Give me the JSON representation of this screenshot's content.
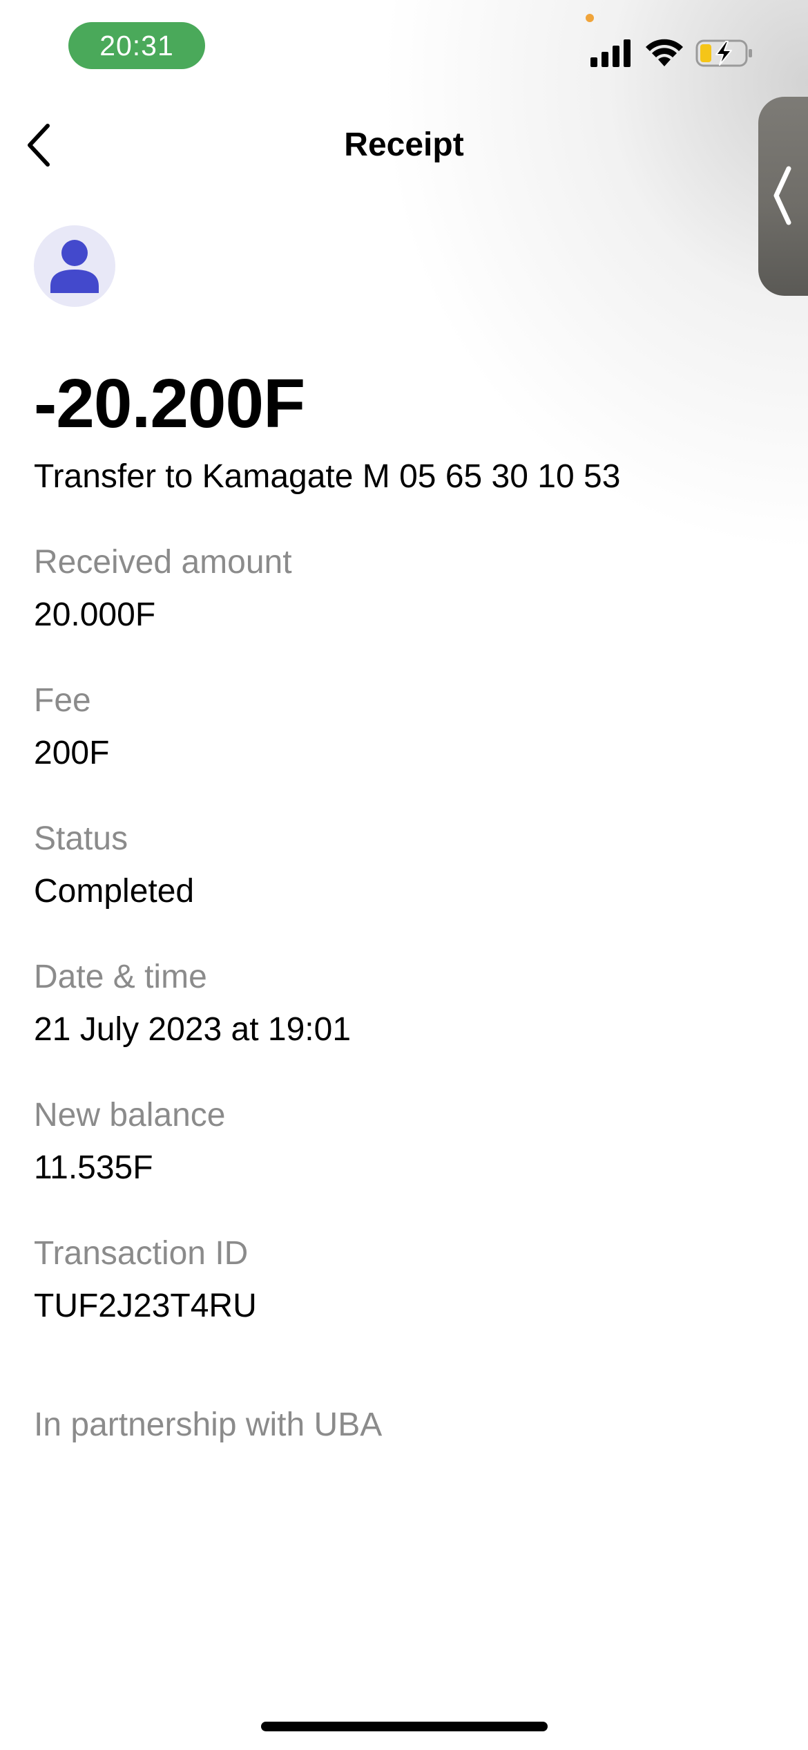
{
  "status_bar": {
    "time": "20:31"
  },
  "header": {
    "title": "Receipt"
  },
  "transaction": {
    "amount": "-20.200F",
    "description": "Transfer to Kamagate M 05 65 30 10 53"
  },
  "details": [
    {
      "label": "Received amount",
      "value": "20.000F"
    },
    {
      "label": "Fee",
      "value": "200F"
    },
    {
      "label": "Status",
      "value": "Completed"
    },
    {
      "label": "Date & time",
      "value": "21 July 2023 at 19:01"
    },
    {
      "label": "New balance",
      "value": "11.535F"
    },
    {
      "label": "Transaction ID",
      "value": "TUF2J23T4RU"
    }
  ],
  "footer": {
    "partner_text": "In partnership with UBA"
  },
  "colors": {
    "time_pill": "#4aa95a",
    "avatar_icon": "#4349cc",
    "avatar_bg": "#e8e8f7",
    "label_gray": "#8b8b8b",
    "battery_fill": "#f5c518"
  },
  "icons": {
    "back": "chevron-left-icon",
    "avatar": "person-icon",
    "signal": "cellular-signal-icon",
    "wifi": "wifi-icon",
    "battery": "battery-charging-icon",
    "side_handle": "chevron-left-icon"
  }
}
